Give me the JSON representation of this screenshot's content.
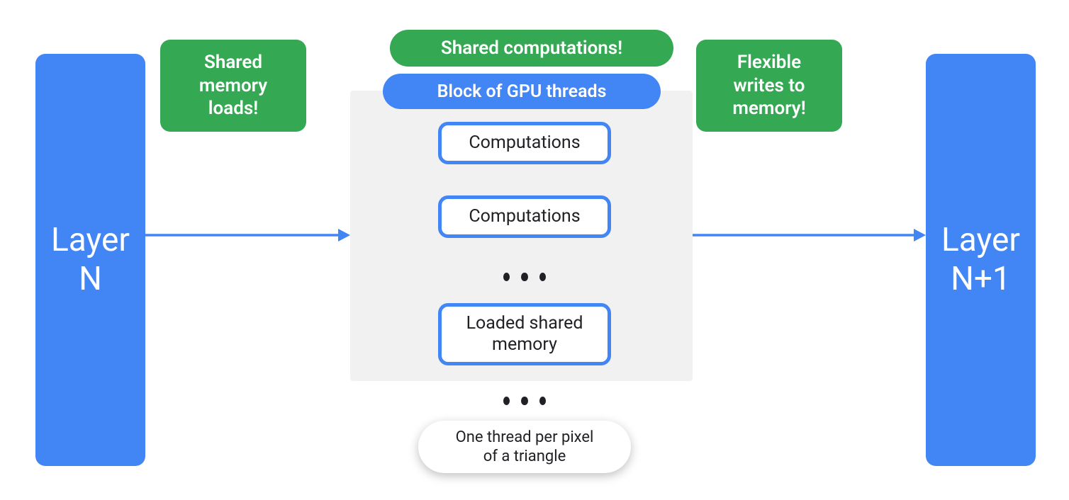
{
  "colors": {
    "blue": "#4285f4",
    "green": "#34a853",
    "panel": "#f1f1f1",
    "text_dark": "#202124"
  },
  "layer_left": "Layer\nN",
  "layer_right": "Layer\nN+1",
  "callouts": {
    "shared_memory_loads": "Shared\nmemory\nloads!",
    "shared_computations": "Shared computations!",
    "flexible_writes": "Flexible\nwrites to\nmemory!"
  },
  "gpu_block": {
    "title": "Block of GPU threads",
    "boxes": {
      "comp1": "Computations",
      "comp2": "Computations",
      "loaded_mem": "Loaded shared\nmemory"
    }
  },
  "footer_note": "One thread per pixel\nof a triangle",
  "ellipsis": "•••"
}
